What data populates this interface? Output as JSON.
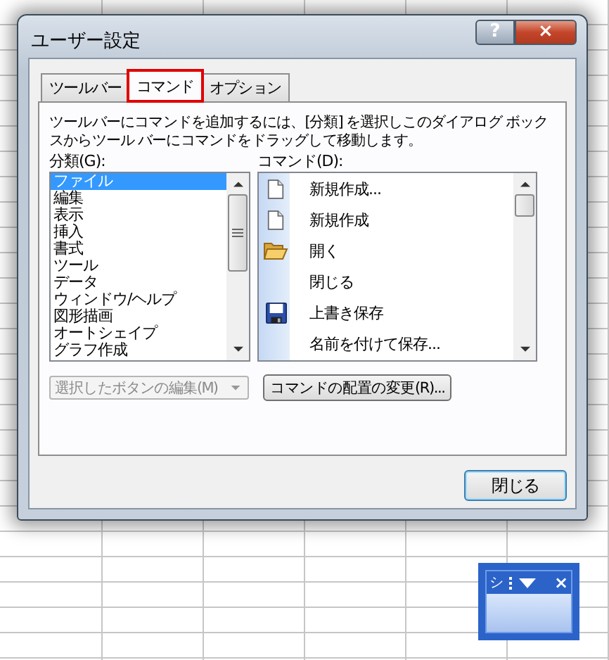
{
  "window": {
    "title": "ユーザー設定",
    "help_button": "?",
    "close_button": "×"
  },
  "tabs": [
    {
      "label": "ツールバー",
      "selected": false,
      "highlighted": false
    },
    {
      "label": "コマンド",
      "selected": true,
      "highlighted": true
    },
    {
      "label": "オプション",
      "selected": false,
      "highlighted": false
    }
  ],
  "description": "ツールバーにコマンドを追加するには、[分類] を選択しこのダイアログ ボックスからツール バーにコマンドをドラッグして移動します。",
  "categories": {
    "label": "分類(G):",
    "items": [
      {
        "label": "ファイル",
        "selected": true
      },
      {
        "label": "編集",
        "selected": false
      },
      {
        "label": "表示",
        "selected": false
      },
      {
        "label": "挿入",
        "selected": false
      },
      {
        "label": "書式",
        "selected": false
      },
      {
        "label": "ツール",
        "selected": false
      },
      {
        "label": "データ",
        "selected": false
      },
      {
        "label": "ウィンドウ/ヘルプ",
        "selected": false
      },
      {
        "label": "図形描画",
        "selected": false
      },
      {
        "label": "オートシェイプ",
        "selected": false
      },
      {
        "label": "グラフ作成",
        "selected": false
      }
    ]
  },
  "commands": {
    "label": "コマンド(D):",
    "items": [
      {
        "label": "新規作成...",
        "kind": "document"
      },
      {
        "label": "新規作成",
        "kind": "document"
      },
      {
        "label": "開く",
        "kind": "folder"
      },
      {
        "label": "閉じる",
        "kind": "plain"
      },
      {
        "label": "上書き保存",
        "kind": "disk"
      },
      {
        "label": "名前を付けて保存...",
        "kind": "plain"
      }
    ]
  },
  "modify_selection": {
    "label": "選択したボタンの編集(M)",
    "disabled": true
  },
  "rearrange_button": {
    "label": "コマンドの配置の変更(R)..."
  },
  "close_button": {
    "label": "閉じる"
  },
  "floating_toolbar": {
    "title": "シ",
    "close": "×"
  }
}
